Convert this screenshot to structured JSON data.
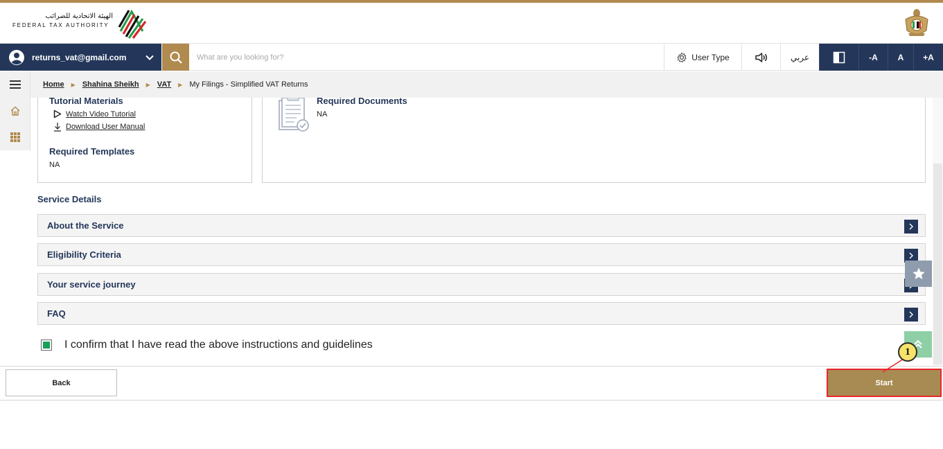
{
  "header": {
    "logo_arabic": "الهيئة الاتحادية للضرائب",
    "logo_english": "FEDERAL TAX AUTHORITY"
  },
  "topbar": {
    "user_email": "returns_vat@gmail.com",
    "search_placeholder": "What are you looking for?",
    "user_type_label": "User Type",
    "arabic_label": "عربي",
    "font_decrease": "-A",
    "font_normal": "A",
    "font_increase": "+A"
  },
  "breadcrumb": {
    "items": [
      "Home",
      "Shahina Sheikh",
      "VAT"
    ],
    "current": "My Filings - Simplified VAT Returns"
  },
  "tutorial": {
    "title": "Tutorial Materials",
    "video_link": "Watch Video Tutorial",
    "manual_link": "Download User Manual",
    "templates_title": "Required Templates",
    "templates_value": "NA"
  },
  "documents": {
    "title": "Required Documents",
    "value": "NA"
  },
  "service": {
    "title": "Service Details",
    "sections": [
      "About the Service",
      "Eligibility Criteria",
      "Your service journey",
      "FAQ"
    ]
  },
  "confirm": {
    "label": "I confirm that I have read the above instructions and guidelines",
    "checked": true
  },
  "footer": {
    "back_label": "Back",
    "start_label": "Start"
  },
  "annotation": {
    "badge": "1"
  },
  "colors": {
    "navy": "#24375a",
    "gold": "#b08a4f",
    "highlight": "#e8262b"
  }
}
